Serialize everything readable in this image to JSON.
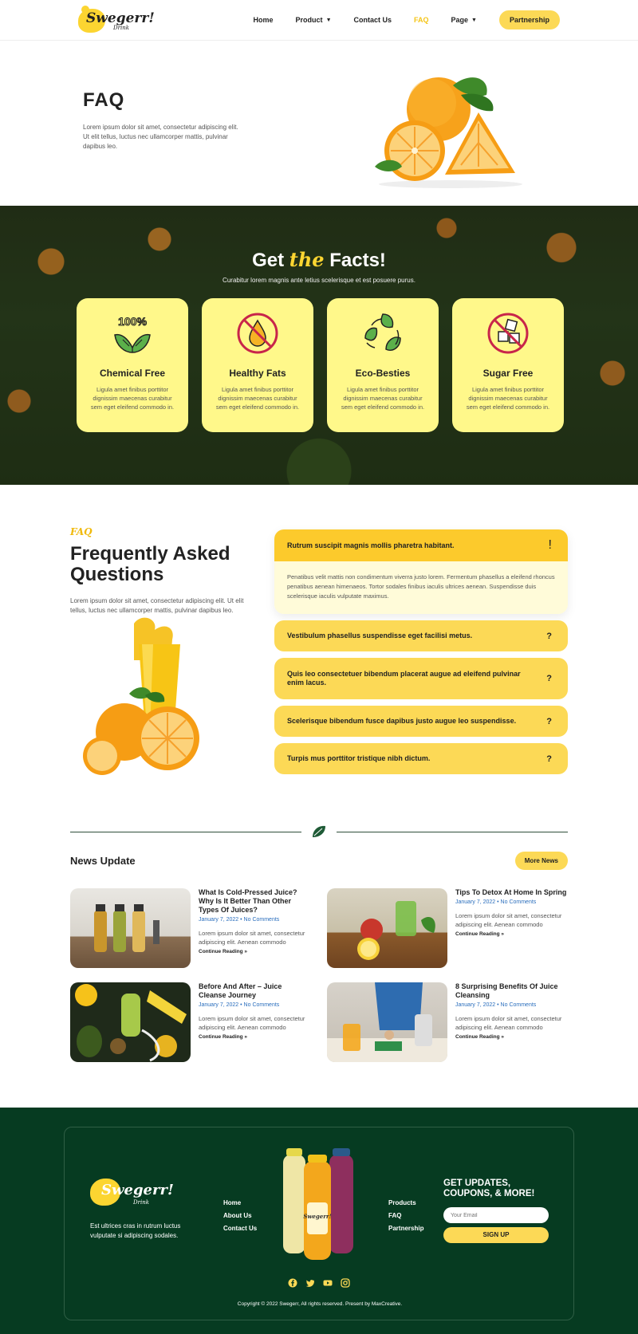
{
  "nav": {
    "logo_text": "Swegerr!",
    "logo_sub": "Drink",
    "items": [
      {
        "label": "Home"
      },
      {
        "label": "Product",
        "has_dropdown": true
      },
      {
        "label": "Contact Us"
      },
      {
        "label": "FAQ",
        "active": true
      },
      {
        "label": "Page",
        "has_dropdown": true
      }
    ],
    "cta": "Partnership"
  },
  "hero": {
    "title": "FAQ",
    "text": "Lorem ipsum dolor sit amet, consectetur adipiscing elit. Ut elit tellus, luctus nec ullamcorper mattis, pulvinar dapibus leo."
  },
  "facts": {
    "title_pre": "Get",
    "title_mid": "the",
    "title_post": "Facts!",
    "subtitle": "Curabitur lorem magnis ante letius scelerisque et est posuere purus.",
    "cards": [
      {
        "icon": "100-percent-natural-icon",
        "title": "Chemical Free",
        "text": "Ligula amet finibus porttitor dignissim maecenas curabitur sem eget eleifend commodo in."
      },
      {
        "icon": "no-fat-icon",
        "title": "Healthy Fats",
        "text": "Ligula amet finibus porttitor dignissim maecenas curabitur sem eget eleifend commodo in."
      },
      {
        "icon": "recycle-leaf-icon",
        "title": "Eco-Besties",
        "text": "Ligula amet finibus porttitor dignissim maecenas curabitur sem eget eleifend commodo in."
      },
      {
        "icon": "no-sugar-icon",
        "title": "Sugar Free",
        "text": "Ligula amet finibus porttitor dignissim maecenas curabitur sem eget eleifend commodo in."
      }
    ]
  },
  "faq": {
    "tag": "FAQ",
    "title": "Frequently Asked Questions",
    "text": "Lorem ipsum dolor sit amet, consectetur adipiscing elit. Ut elit tellus, luctus nec ullamcorper mattis, pulvinar dapibus leo.",
    "open": {
      "question": "Rutrum suscipit magnis mollis pharetra habitant.",
      "marker": "!",
      "answer": "Penatibus velit mattis non condimentum viverra justo lorem. Fermentum phasellus a eleifend rhoncus penatibus aenean himenaeos. Tortor sodales finibus iaculis ultrices aenean. Suspendisse duis scelerisque iaculis vulputate maximus."
    },
    "items": [
      {
        "question": "Vestibulum phasellus suspendisse eget facilisi metus.",
        "marker": "?"
      },
      {
        "question": "Quis leo consectetuer bibendum placerat augue ad eleifend pulvinar enim lacus.",
        "marker": "?"
      },
      {
        "question": "Scelerisque bibendum fusce dapibus justo augue leo suspendisse.",
        "marker": "?"
      },
      {
        "question": "Turpis mus porttitor tristique nibh dictum.",
        "marker": "?"
      }
    ]
  },
  "news": {
    "title": "News Update",
    "more": "More News",
    "posts": [
      {
        "title": "What Is Cold-Pressed Juice? Why Is It Better Than Other Types Of Juices?",
        "date": "January 7, 2022",
        "comments": "No Comments",
        "excerpt": "Lorem ipsum dolor sit amet, consectetur adipiscing elit. Aenean commodo",
        "more": "Continue Reading »"
      },
      {
        "title": "Tips To Detox At Home In Spring",
        "date": "January 7, 2022",
        "comments": "No Comments",
        "excerpt": "Lorem ipsum dolor sit amet, consectetur adipiscing elit. Aenean commodo",
        "more": "Continue Reading »"
      },
      {
        "title": "Before And After – Juice Cleanse Journey",
        "date": "January 7, 2022",
        "comments": "No Comments",
        "excerpt": "Lorem ipsum dolor sit amet, consectetur adipiscing elit. Aenean commodo",
        "more": "Continue Reading »"
      },
      {
        "title": "8 Surprising Benefits Of Juice Cleansing",
        "date": "January 7, 2022",
        "comments": "No Comments",
        "excerpt": "Lorem ipsum dolor sit amet, consectetur adipiscing elit. Aenean commodo",
        "more": "Continue Reading »"
      }
    ]
  },
  "footer": {
    "logo_text": "Swegerr!",
    "logo_sub": "Drink",
    "desc": "Est ultrices cras in rutrum luctus vulputate si adipiscing sodales.",
    "links1": [
      "Home",
      "About Us",
      "Contact Us"
    ],
    "links2": [
      "Products",
      "FAQ",
      "Partnership"
    ],
    "updates_title": "GET UPDATES, COUPONS, & MORE!",
    "email_placeholder": "Your Email",
    "signup": "SIGN UP",
    "socials": [
      "facebook-icon",
      "twitter-icon",
      "youtube-icon",
      "instagram-icon"
    ],
    "copyright": "Copyright © 2022 Swegerr, All rights reserved. Present by MaxCreative."
  },
  "colors": {
    "accent": "#fcd956",
    "accent_dark": "#fcca2c",
    "card": "#fff88a",
    "footer": "#063b21",
    "link": "#2a6ebd"
  }
}
